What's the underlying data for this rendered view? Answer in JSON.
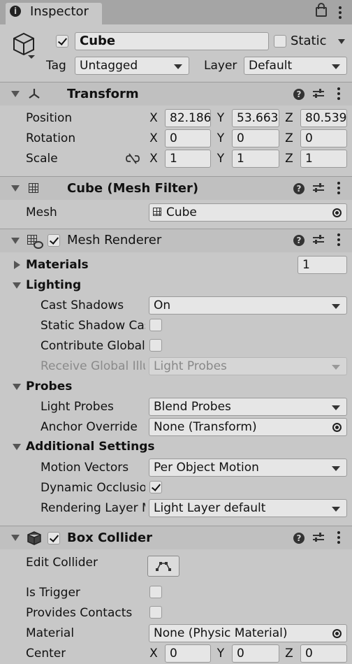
{
  "tab": {
    "label": "Inspector"
  },
  "object": {
    "name": "Cube",
    "active": true,
    "static_label": "Static",
    "static": false,
    "tag_label": "Tag",
    "tag": "Untagged",
    "layer_label": "Layer",
    "layer": "Default"
  },
  "transform": {
    "title": "Transform",
    "position": {
      "label": "Position",
      "x": "82.1864",
      "y": "53.663",
      "z": "80.539"
    },
    "rotation": {
      "label": "Rotation",
      "x": "0",
      "y": "0",
      "z": "0"
    },
    "scale": {
      "label": "Scale",
      "x": "1",
      "y": "1",
      "z": "1"
    }
  },
  "axes": {
    "x": "X",
    "y": "Y",
    "z": "Z"
  },
  "mesh_filter": {
    "title": "Cube (Mesh Filter)",
    "mesh_label": "Mesh",
    "mesh_value": "Cube"
  },
  "mesh_renderer": {
    "title": "Mesh Renderer",
    "enabled": true,
    "materials": {
      "label": "Materials",
      "count": "1"
    },
    "lighting": {
      "label": "Lighting",
      "cast_shadows_label": "Cast Shadows",
      "cast_shadows": "On",
      "static_shadow_label": "Static Shadow Caster",
      "contribute_gi_label": "Contribute Global Illumination",
      "receive_gi_label": "Receive Global Illumination",
      "receive_gi": "Light Probes"
    },
    "probes": {
      "label": "Probes",
      "light_probes_label": "Light Probes",
      "light_probes": "Blend Probes",
      "anchor_label": "Anchor Override",
      "anchor": "None (Transform)"
    },
    "additional": {
      "label": "Additional Settings",
      "motion_vectors_label": "Motion Vectors",
      "motion_vectors": "Per Object Motion",
      "dynamic_occlusion_label": "Dynamic Occlusion",
      "dynamic_occlusion": true,
      "rendering_layer_label": "Rendering Layer Mask",
      "rendering_layer": "Light Layer default"
    }
  },
  "box_collider": {
    "title": "Box Collider",
    "enabled": true,
    "edit_label": "Edit Collider",
    "is_trigger_label": "Is Trigger",
    "provides_contacts_label": "Provides Contacts",
    "material_label": "Material",
    "material": "None (Physic Material)",
    "center_label": "Center",
    "center": {
      "x": "0",
      "y": "0",
      "z": "0"
    }
  }
}
